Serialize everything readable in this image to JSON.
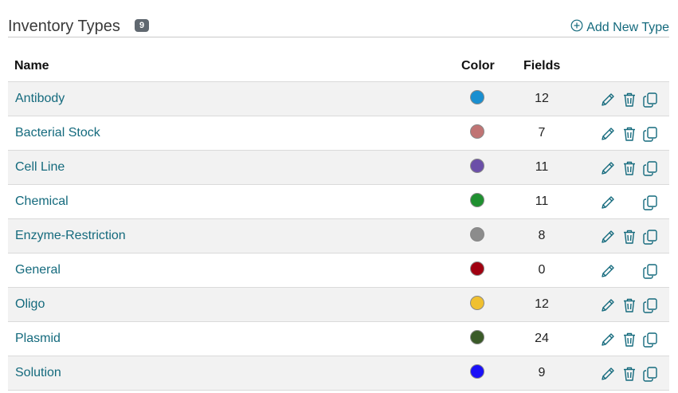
{
  "header": {
    "title": "Inventory Types",
    "count": "9",
    "add_label": "Add New Type"
  },
  "columns": {
    "name": "Name",
    "color": "Color",
    "fields": "Fields"
  },
  "rows": [
    {
      "name": "Antibody",
      "color": "#1a8fd0",
      "fields": "12",
      "deletable": true
    },
    {
      "name": "Bacterial Stock",
      "color": "#c07474",
      "fields": "7",
      "deletable": true
    },
    {
      "name": "Cell Line",
      "color": "#6b4fa8",
      "fields": "11",
      "deletable": true
    },
    {
      "name": "Chemical",
      "color": "#1f9030",
      "fields": "11",
      "deletable": false
    },
    {
      "name": "Enzyme-Restriction",
      "color": "#8c8c8c",
      "fields": "8",
      "deletable": true
    },
    {
      "name": "General",
      "color": "#a00010",
      "fields": "0",
      "deletable": false
    },
    {
      "name": "Oligo",
      "color": "#f0c030",
      "fields": "12",
      "deletable": true
    },
    {
      "name": "Plasmid",
      "color": "#3a5a28",
      "fields": "24",
      "deletable": true
    },
    {
      "name": "Solution",
      "color": "#1a10f8",
      "fields": "9",
      "deletable": true
    }
  ],
  "icons": {
    "add": "plus-circle-icon",
    "edit": "pencil-icon",
    "delete": "trash-icon",
    "copy": "copy-icon"
  },
  "accent_color": "#146a7d"
}
